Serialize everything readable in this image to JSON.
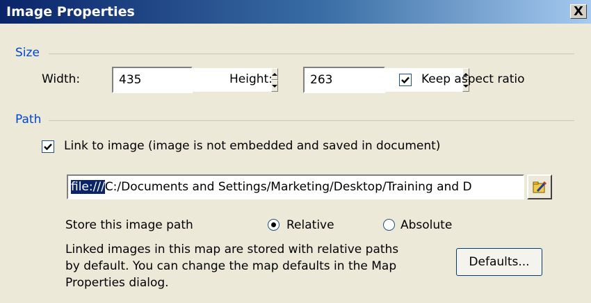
{
  "window": {
    "title": "Image Properties",
    "close_label": "X"
  },
  "size_group": {
    "label": "Size",
    "width_label": "Width:",
    "width_value": "435",
    "height_label": "Height:",
    "height_value": "263",
    "keep_aspect_label": "Keep aspect ratio",
    "keep_aspect_checked": true
  },
  "path_group": {
    "label": "Path",
    "link_label": "Link to image (image is not embedded and saved in document)",
    "link_checked": true,
    "path_selected": "file:///",
    "path_rest": "C:/Documents and Settings/Marketing/Desktop/Training and D",
    "store_label": "Store this image path",
    "relative_label": "Relative",
    "absolute_label": "Absolute",
    "selected_option": "Relative",
    "description_lines": [
      "Linked images in this map are stored with relative paths",
      "by default. You can change the map defaults in the Map",
      "Properties dialog."
    ],
    "defaults_button": "Defaults..."
  },
  "icons": {
    "browse": "browse-folder-icon",
    "check": "checkmark-icon",
    "close": "close-icon"
  },
  "colors": {
    "title_start": "#0A246A",
    "title_end": "#A6CAF0",
    "group_label": "#0046D5",
    "dialog_bg": "#ECE9D8",
    "selection": "#0A246A"
  }
}
